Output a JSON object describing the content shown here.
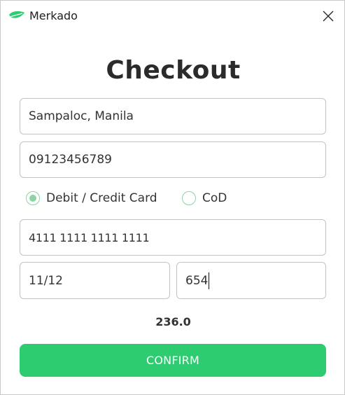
{
  "window": {
    "title": "Merkado",
    "app_icon": "leaf-icon",
    "close_icon": "close-icon"
  },
  "checkout": {
    "heading": "Checkout",
    "address_value": "Sampaloc, Manila",
    "phone_value": "09123456789",
    "payment_options": [
      {
        "label": "Debit / Credit Card",
        "selected": true
      },
      {
        "label": "CoD",
        "selected": false
      }
    ],
    "card_number_value": "4111 1111 1111 1111",
    "expiry_value": "11/12",
    "cvv_value": "654",
    "total": "236.0",
    "confirm_label": "CONFIRM"
  },
  "colors": {
    "accent": "#2ecc71",
    "radio": "#8ed3a4",
    "heading": "#2b2b2b"
  }
}
